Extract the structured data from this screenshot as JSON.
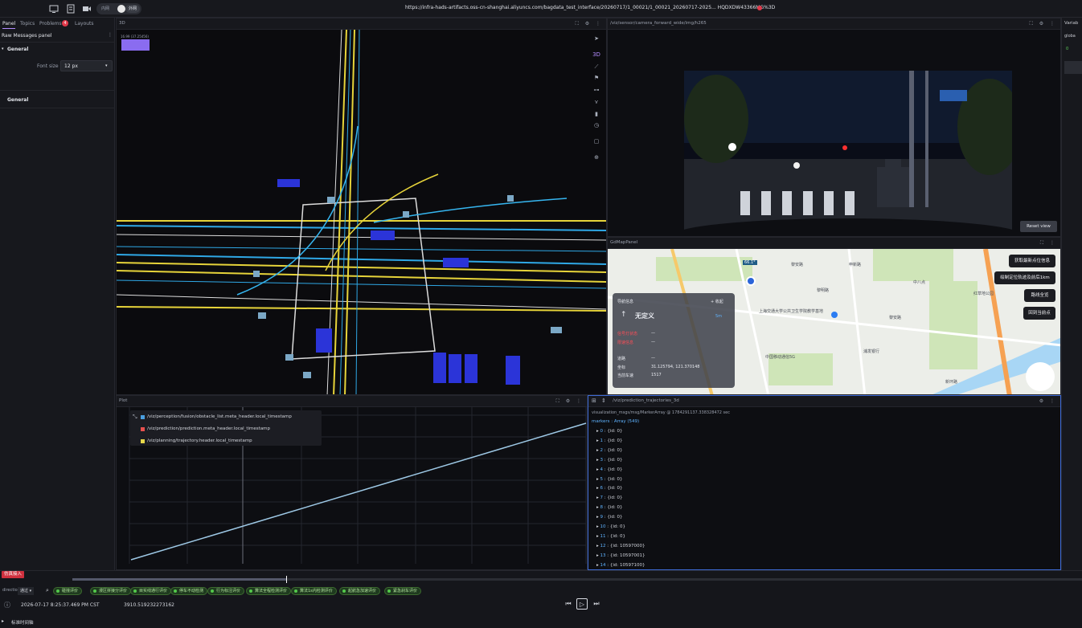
{
  "topbar": {
    "url": "https://infra-hads-artifacts.oss-cn-shanghai.aliyuncs.com/bagdata_test_interface/20260717/1_00021/1_00021_20260717-2025... HQDXDW43366MG%3D",
    "toggle_off": "内网",
    "toggle_on": "外网"
  },
  "sidebar": {
    "tabs": [
      "Panel",
      "Topics",
      "Problems",
      "Layouts"
    ],
    "problems_count": "4",
    "panel_title": "Raw Messages panel",
    "section_general": "General",
    "font_size_label": "Font size",
    "font_size_value": "12 px",
    "section_general2": "General"
  },
  "panels": {
    "three_d": "3D",
    "three_d_chip": "16.99 (37.25456)",
    "camera": "/viz/sensor/camera_forward_wide/img/h265",
    "camera_reset": "Reset view",
    "map": "GdMapPanel",
    "plot": "Plot",
    "tree": "/viz/prediction_trajectories_3d",
    "right": "Variab"
  },
  "map": {
    "buttons": [
      "获取最新点位信息",
      "绘制定位轨迹及前后1km",
      "路线全览",
      "回到当前点"
    ],
    "card_title": "导航信息",
    "card_road": "无定义",
    "card_action": "+ 收起",
    "card_value": "5m",
    "card_rows": [
      {
        "label": "信号灯状态",
        "value": "—",
        "red": true
      },
      {
        "label": "限速信息",
        "value": "—",
        "red": true
      },
      {
        "label": "道路",
        "value": "—",
        "red": false
      },
      {
        "label": "坐标",
        "value": "31.125794, 121.370148",
        "red": false
      },
      {
        "label": "当前车速",
        "value": "1517",
        "red": false
      }
    ],
    "labels": [
      "上海交通大学公共卫生学院教学基地",
      "中国移动通信5G",
      "黎安路",
      "黎明路",
      "浦发银行",
      "申新路",
      "中八点",
      "红草地公园",
      "新环路",
      "黎安路"
    ],
    "speed": "66.1°"
  },
  "plot": {
    "legend": [
      {
        "name": "/viz/perception/fusion/obstacle_list.meta_header.local_timestamp",
        "color": "#4a9fe0"
      },
      {
        "name": "/viz/prediction/prediction.meta_header.local_timestamp",
        "color": "#e8504e"
      },
      {
        "name": "/viz/planning/trajectory.header.local_timestamp",
        "color": "#e7d84a"
      }
    ]
  },
  "tree": {
    "header": "visualization_msgs/msg/MarkerArray @ 1784291137.338328472 sec",
    "root": "markers : Array (549)",
    "rows": [
      {
        "idx": "0",
        "val": "{id: 0}"
      },
      {
        "idx": "1",
        "val": "{id: 0}"
      },
      {
        "idx": "2",
        "val": "{id: 0}"
      },
      {
        "idx": "3",
        "val": "{id: 0}"
      },
      {
        "idx": "4",
        "val": "{id: 0}"
      },
      {
        "idx": "5",
        "val": "{id: 0}"
      },
      {
        "idx": "6",
        "val": "{id: 0}"
      },
      {
        "idx": "7",
        "val": "{id: 0}"
      },
      {
        "idx": "8",
        "val": "{id: 0}"
      },
      {
        "idx": "9",
        "val": "{id: 0}"
      },
      {
        "idx": "10",
        "val": "{id: 0}"
      },
      {
        "idx": "11",
        "val": "{id: 0}"
      },
      {
        "idx": "12",
        "val": "{id: 10597000}"
      },
      {
        "idx": "13",
        "val": "{id: 10597001}"
      },
      {
        "idx": "14",
        "val": "{id: 10597100}"
      }
    ]
  },
  "bottom": {
    "red_tag": "仿真接入",
    "chips": [
      "碰撞评价",
      "漫区拼接分评价",
      "目实线通行评价",
      "停车不动检测",
      "行为标注评价",
      "算法全程检测评价",
      "算法1s内检测评价",
      "起航急加速评价",
      "紧急刹车评价"
    ],
    "label": "direction",
    "select": "通过 ▾",
    "timestamp": "2026-07-17 8:25:37.469 PM CST",
    "seconds": "3910.519232273162",
    "note": "标准时间轴"
  },
  "rightstrip": {
    "values": [
      "globa",
      "0",
      "0.6"
    ]
  }
}
